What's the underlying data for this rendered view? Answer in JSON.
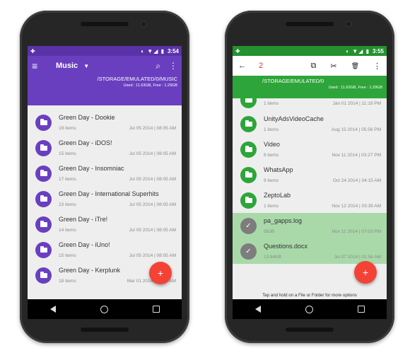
{
  "colors": {
    "left_accent": "#6a3fbf",
    "right_accent": "#2ea53a",
    "selection": "#a9d9a9",
    "fab": "#f44336"
  },
  "left": {
    "status": {
      "time": "3:54",
      "icons": "◐ ▼◢ ▮"
    },
    "toolbar": {
      "title": "Music",
      "menu_icon": "≡",
      "search_icon": "⌕",
      "more_icon": "⋮",
      "caret": "▼"
    },
    "path": "/STORAGE/EMULATED/0/MUSIC",
    "storage": "Used : 11.63GB, Free : 1.29GB",
    "items": [
      {
        "name": "Green Day - Dookie",
        "count": "19 items",
        "date": "Jul 05 2014 | 08:05 AM"
      },
      {
        "name": "Green Day - iDOS!",
        "count": "15 items",
        "date": "Jul 05 2014 | 08:05 AM"
      },
      {
        "name": "Green Day - Insomniac",
        "count": "17 items",
        "date": "Jul 05 2014 | 08:05 AM"
      },
      {
        "name": "Green Day - International Superhits",
        "count": "23 items",
        "date": "Jul 05 2014 | 08:05 AM"
      },
      {
        "name": "Green Day - iTre!",
        "count": "14 items",
        "date": "Jul 05 2014 | 08:05 AM"
      },
      {
        "name": "Green Day - iUno!",
        "count": "15 items",
        "date": "Jul 05 2014 | 08:05 AM"
      },
      {
        "name": "Green Day - Kerplunk",
        "count": "18 items",
        "date": "Mar 01 2014 | 08:05 AM"
      }
    ],
    "fab": "+"
  },
  "right": {
    "status": {
      "time": "3:55",
      "icons": "◐ ▼◢ ▮"
    },
    "actionbar": {
      "back": "←",
      "count": "2",
      "copy": "⧉",
      "cut": "✂",
      "delete": "🗑",
      "more": "⋮"
    },
    "path": "/STORAGE/EMULATED/0",
    "storage": "Used : 11.63GB, Free : 1.29GB",
    "partial": {
      "count": "1 items",
      "date": "Jan 01 2014 | 11:19 PM"
    },
    "items": [
      {
        "name": "UnityAdsVideoCache",
        "count": "1 items",
        "date": "Aug 15 2014 | 05:56 PM"
      },
      {
        "name": "Video",
        "count": "6 items",
        "date": "Nov 11 2014 | 03:27 PM"
      },
      {
        "name": "WhatsApp",
        "count": "9 items",
        "date": "Oct 24 2014 | 04:15 AM"
      },
      {
        "name": "ZeptoLab",
        "count": "1 items",
        "date": "Nov 12 2014 | 03:39 AM"
      }
    ],
    "selected": [
      {
        "name": "pa_gapps.log",
        "count": "563B",
        "date": "Nov 11 2014 | 07:03 PM"
      },
      {
        "name": "Questions.docx",
        "count": "13.84KB",
        "date": "Jul 07 2014 | 01:56 AM"
      }
    ],
    "hint": "Tap and hold on a File or Folder for more options",
    "fab": "+"
  }
}
